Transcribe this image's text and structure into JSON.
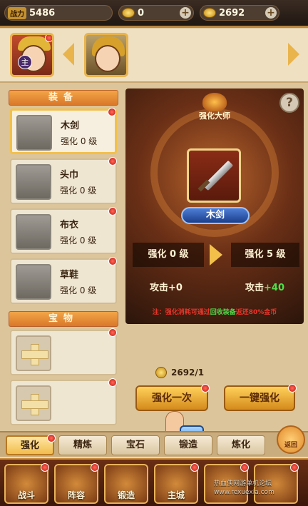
{
  "topbar": {
    "power_label": "战力",
    "power_value": "5486",
    "gold_value": "0",
    "gem_value": "2692"
  },
  "heroes": {
    "main_tag": "主"
  },
  "equipment": {
    "section_title": "装备",
    "items": [
      {
        "name": "木剑",
        "level": "强化 0 级",
        "icon": "sword-icon"
      },
      {
        "name": "头巾",
        "level": "强化 0 级",
        "icon": "headband-icon"
      },
      {
        "name": "布衣",
        "level": "强化 0 级",
        "icon": "cloth-armor-icon"
      },
      {
        "name": "草鞋",
        "level": "强化 0 级",
        "icon": "straw-sandals-icon"
      }
    ]
  },
  "treasure": {
    "section_title": "宝物"
  },
  "panel": {
    "master_label": "强化大师",
    "item_name": "木剑",
    "current_level": "强化 0 级",
    "next_level": "强化 5 级",
    "current_attack": "攻击+0",
    "next_attack_label": "攻击",
    "next_attack_value": "+40",
    "tip_prefix": "注：强化消耗可通过",
    "tip_highlight": "回收装备",
    "tip_suffix": "返还80%金币"
  },
  "actions": {
    "cost": "2692/1",
    "enhance_label": "强化一次",
    "one_key_label": "一键强化"
  },
  "tabs": [
    "强化",
    "精炼",
    "宝石",
    "锻造",
    "炼化"
  ],
  "active_tab": 0,
  "back_label": "返回",
  "bottom_nav": [
    "战斗",
    "阵容",
    "锻造",
    "主城",
    "",
    ""
  ],
  "watermark": {
    "line1": "热血侠网游单机论坛",
    "line2": "www.rexuexia.com"
  },
  "colors": {
    "accent": "#f2c04a",
    "red_dot": "#c2160c",
    "attack_gain": "#4ee04a",
    "tip_red": "#e8352a"
  }
}
